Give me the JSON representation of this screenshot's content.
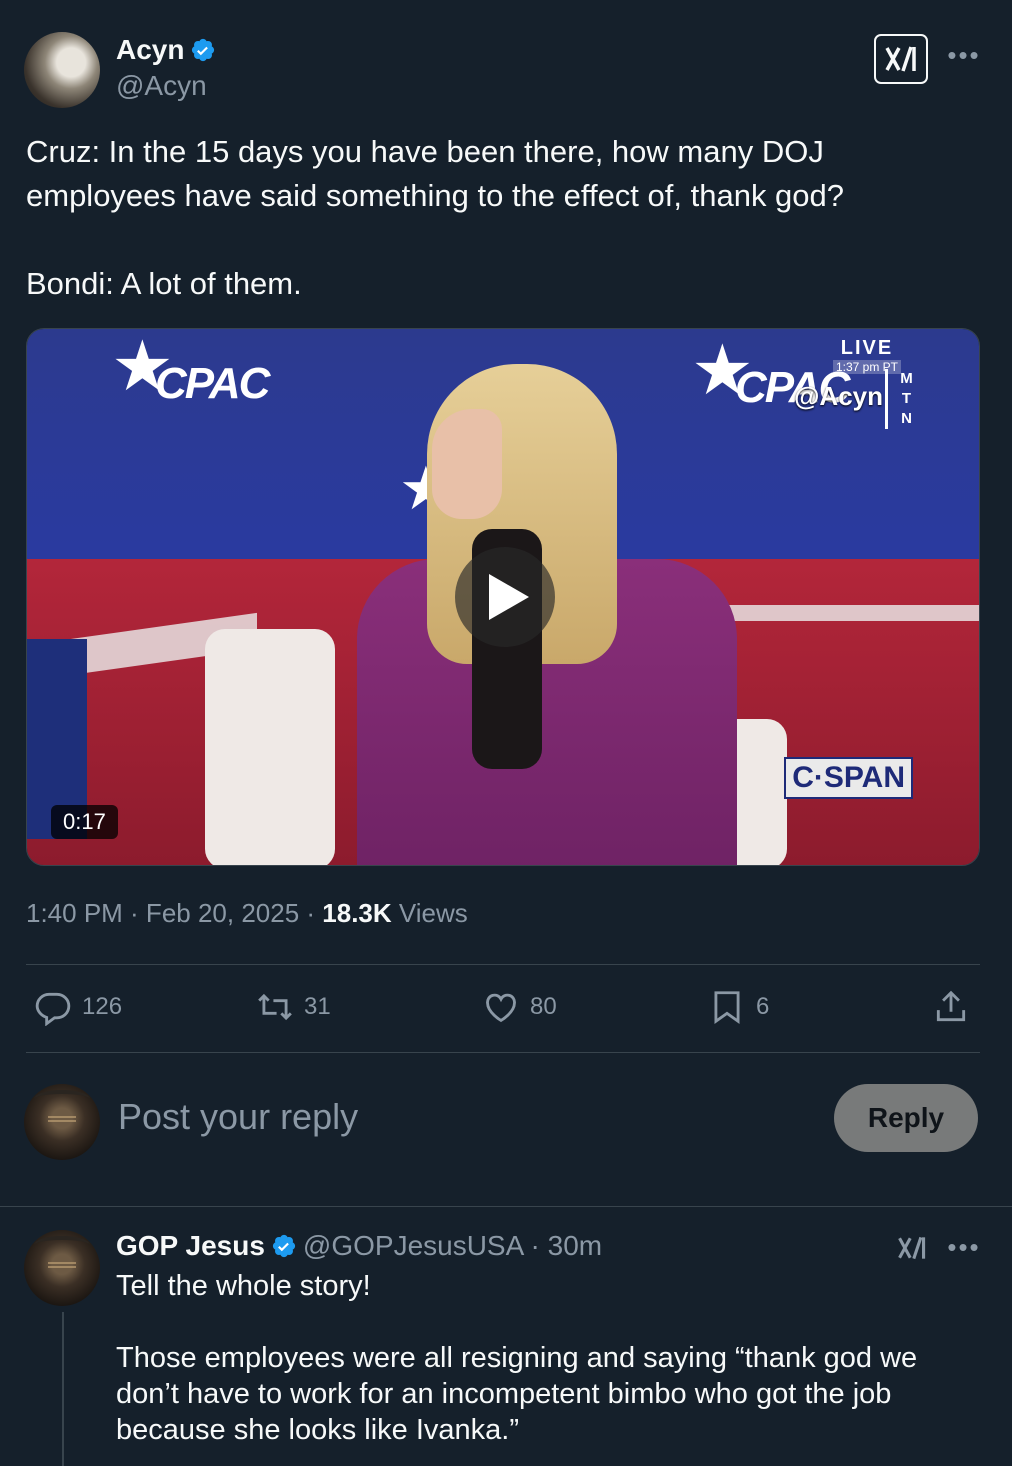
{
  "tweet": {
    "author": {
      "display_name": "Acyn",
      "handle": "@Acyn",
      "avatar": "profile-photo"
    },
    "text": "Cruz: In the 15 days you have been there, how many DOJ employees have said something to the effect of, thank god?\n\nBondi: A lot of them.",
    "video": {
      "duration": "0:17",
      "overlay_live": "LIVE",
      "overlay_time": "1:37 pm PT",
      "overlay_handle": "@Acyn",
      "overlay_mtn": [
        "M",
        "T",
        "N"
      ],
      "logo_left": "CPAC",
      "logo_right": "CPAC",
      "network": "C·SPAN"
    },
    "timestamp": "1:40 PM · Feb 20, 2025 · ",
    "views_count": "18.3K",
    "views_label": "Views",
    "actions": {
      "replies": "126",
      "reposts": "31",
      "likes": "80",
      "bookmarks": "6"
    }
  },
  "composer": {
    "placeholder": "Post your reply",
    "button_label": "Reply"
  },
  "reply": {
    "display_name": "GOP Jesus",
    "handle_time": "@GOPJesusUSA · 30m",
    "text": "Tell the whole story!\n\nThose employees were all resigning and saying “thank god we don’t have to work for an incompetent bimbo who got the job because she looks like Ivanka.”"
  },
  "colors": {
    "background": "#15202b",
    "text": "#f7f9f9",
    "muted": "#8b98a5",
    "verified": "#1d9bf0",
    "divider": "#38444d"
  },
  "icons": [
    "verified-badge-icon",
    "grok-icon",
    "more-icon",
    "play-icon",
    "reply-icon",
    "repost-icon",
    "like-icon",
    "bookmark-icon",
    "share-icon"
  ]
}
